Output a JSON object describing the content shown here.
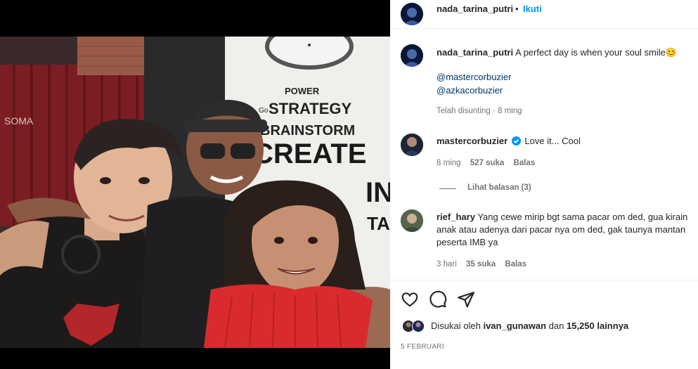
{
  "post": {
    "author": "nada_tarina_putri",
    "dot": "•",
    "follow_label": "Ikuti",
    "caption": "A perfect day is when your soul smile",
    "caption_emoji": "😊",
    "mentions": [
      "@mastercorbuzier",
      "@azkacorbuzier"
    ],
    "edited_label": "Telah disunting",
    "edited_sep": "·",
    "edited_time": "8 ming"
  },
  "photo_text": {
    "power": "POWER",
    "strategy": "STRATEGY",
    "strategy_prefix": "Go",
    "brainstorm": "BRAINSTORM",
    "create": "CREATE",
    "in": "IN",
    "ta": "TA",
    "sign": "SOMA"
  },
  "comments": [
    {
      "username": "mastercorbuzier",
      "verified": true,
      "text": "Love it... Cool",
      "time": "8 ming",
      "likes": "527 suka",
      "reply_label": "Balas",
      "view_replies": "Lihat balasan (3)"
    },
    {
      "username": "rief_hary",
      "verified": false,
      "text_lines": [
        "Yang cewe mirip bgt sama pacar om ded, gua kirain",
        "anak atau adenya dari pacar nya om ded, gak taunya mantan",
        "peserta IMB ya"
      ],
      "time": "3 hari",
      "likes": "35 suka",
      "reply_label": "Balas"
    }
  ],
  "likes": {
    "prefix": "Disukai oleh",
    "user": "ivan_gunawan",
    "middle": "dan",
    "count": "15,250 lainnya"
  },
  "date": "5 FEBRUARI",
  "icons": [
    "heart-icon",
    "comment-icon",
    "share-icon",
    "verified-badge-icon"
  ],
  "colors": {
    "follow_blue": "#0095f6",
    "link_blue": "#00376b",
    "meta_gray": "#737373",
    "dress_red": "#d92b2f"
  }
}
